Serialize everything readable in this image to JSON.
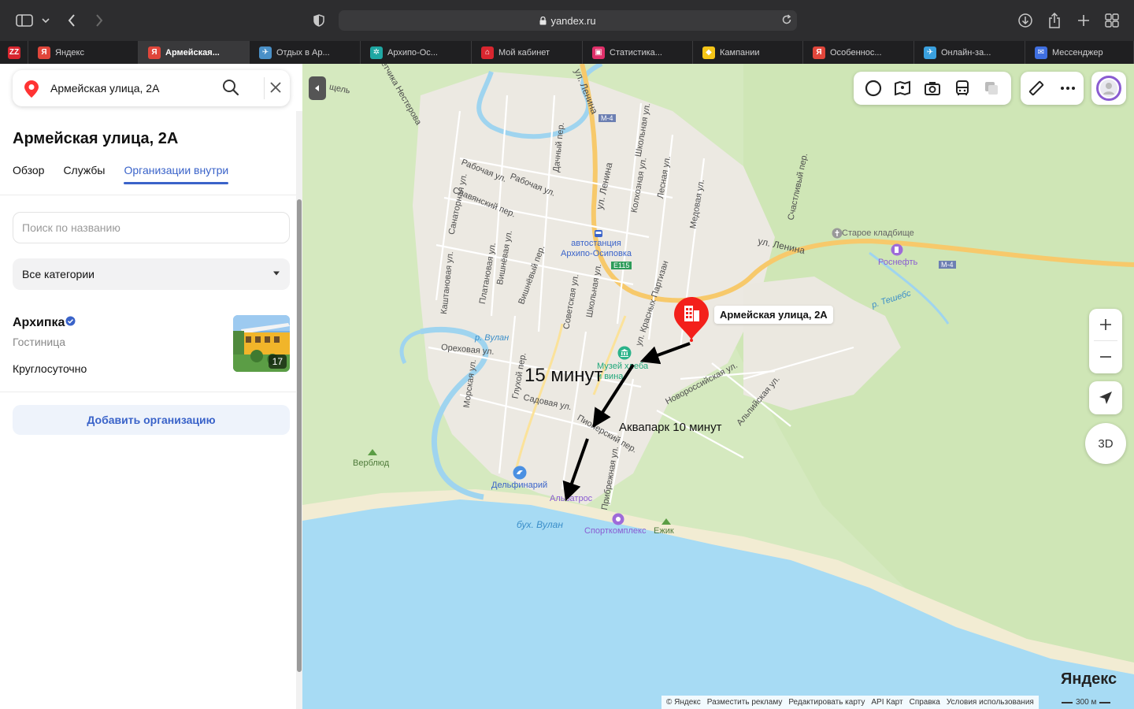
{
  "browser": {
    "url": "yandex.ru",
    "tabs": [
      {
        "label": "",
        "favicon": "ZZ",
        "color": "#d8262f"
      },
      {
        "label": "Яндекс",
        "favicon": "Я",
        "color": "#e0463b"
      },
      {
        "label": "Армейская...",
        "favicon": "Я",
        "color": "#e0463b",
        "active": true
      },
      {
        "label": "Отдых в Ар...",
        "favicon": "✈",
        "color": "#4a90c7"
      },
      {
        "label": "Архипо-Ос...",
        "favicon": "✲",
        "color": "#1fa7a3"
      },
      {
        "label": "Мой кабинет",
        "favicon": "⌂",
        "color": "#d8262f"
      },
      {
        "label": "Статистика...",
        "favicon": "▣",
        "color": "#e0306a"
      },
      {
        "label": "Кампании",
        "favicon": "◆",
        "color": "#f5c518"
      },
      {
        "label": "Особеннос...",
        "favicon": "Я",
        "color": "#e0463b"
      },
      {
        "label": "Онлайн-за...",
        "favicon": "✈",
        "color": "#3aa0de"
      },
      {
        "label": "Мессенджер",
        "favicon": "✉",
        "color": "#3f6fe0"
      }
    ]
  },
  "sidebar": {
    "search_query": "Армейская улица, 2А",
    "title": "Армейская улица, 2А",
    "tabs": [
      {
        "label": "Обзор"
      },
      {
        "label": "Службы"
      },
      {
        "label": "Организации внутри",
        "active": true
      }
    ],
    "org_search_placeholder": "Поиск по названию",
    "category": "Все категории",
    "organization": {
      "name": "Архипка",
      "type": "Гостиница",
      "hours": "Круглосуточно",
      "photo_count": "17",
      "verified": true
    },
    "add_button": "Добавить организацию"
  },
  "map": {
    "pin_label": "Армейская улица, 2А",
    "annotation_time": "15 минут",
    "annotation_aqua": "Аквапарк 10 минут",
    "logo": "Яндекс",
    "scale": "300 м",
    "zoom_in": "+",
    "zoom_out": "−",
    "three_d": "3D",
    "copyright_links": [
      "© Яндекс",
      "Разместить рекламу",
      "Редактировать карту",
      "API Карт",
      "Справка",
      "Условия использования"
    ],
    "labels": {
      "lenina1": "ул. Ленина",
      "lenina2": "ул. Ленина",
      "lenina3": "ул. Ленина",
      "m4a": "М-4",
      "m4b": "М-4",
      "e115": "E115",
      "busstation": "автостанция\nАрхипо-Осиповка",
      "cemetery": "Старое кладбище",
      "rosneft": "Роснефть",
      "teshebs": "р. Тешебс",
      "vulan_river": "р. Вулан",
      "museum": "Музей хлеба\nи вина",
      "dolphinarium": "Дельфинарий",
      "albatros": "Альбатрос",
      "bay": "бух. Вулан",
      "sport": "Спорткомплекс",
      "ezhik": "Ежик",
      "verblyud": "Верблюд",
      "rabochaya1": "Рабочая ул.",
      "rabochaya2": "Рабочая ул.",
      "slavyansky": "Славянский пер.",
      "sanatornaya": "Санаторная ул.",
      "kashtanovaya": "Каштановая ул.",
      "platanovaya": "Платановая ул.",
      "vishnevaya1": "Вишнёвая ул.",
      "vishnevaya2": "Вишнёвый пер.",
      "sovetskaya": "Советская ул.",
      "shkolnaya1": "Школьная ул.",
      "shkolnaya2": "Школьная ул.",
      "kolhoznaya": "Колхозная ул.",
      "lesnaya": "Лесная ул.",
      "medovaya": "Медовая ул.",
      "schastlivy": "Счастливый пер.",
      "krasnyh": "ул. Красных Партизан",
      "orehovaya": "Ореховая ул.",
      "morskaya": "Морская ул.",
      "gluhoy": "Глухой пер.",
      "sadovaya": "Садовая ул.",
      "pionersky": "Пионерский пер.",
      "pribrezhnaya": "Прибрежная ул.",
      "novorossiyskaya": "Новороссийская ул.",
      "alpiyskaya": "Альпийская ул.",
      "nesterova": "Летчика Нестерова",
      "ushel": "щель",
      "dachny": "Дачный пер."
    }
  }
}
